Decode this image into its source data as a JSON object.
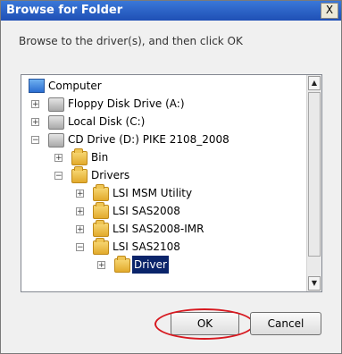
{
  "window": {
    "title": "Browse for Folder",
    "close_glyph": "X"
  },
  "instruction": "Browse to the driver(s), and then click OK",
  "tree": {
    "items": [
      {
        "label": "Computer",
        "icon": "computer-icon",
        "expander": ""
      },
      {
        "label": "Floppy Disk Drive (A:)",
        "icon": "floppy-drive-icon",
        "expander": "+"
      },
      {
        "label": "Local Disk (C:)",
        "icon": "hard-drive-icon",
        "expander": "+"
      },
      {
        "label": "CD Drive (D:) PIKE 2108_2008",
        "icon": "cd-drive-icon",
        "expander": "−"
      },
      {
        "label": "Bin",
        "icon": "folder-icon",
        "expander": "+"
      },
      {
        "label": "Drivers",
        "icon": "folder-icon",
        "expander": "−"
      },
      {
        "label": "LSI MSM Utility",
        "icon": "folder-icon",
        "expander": "+"
      },
      {
        "label": "LSI SAS2008",
        "icon": "folder-icon",
        "expander": "+"
      },
      {
        "label": "LSI SAS2008-IMR",
        "icon": "folder-icon",
        "expander": "+"
      },
      {
        "label": "LSI SAS2108",
        "icon": "folder-icon",
        "expander": "−"
      },
      {
        "label": "Driver",
        "icon": "folder-icon",
        "expander": "+",
        "selected": true
      }
    ]
  },
  "buttons": {
    "ok": "OK",
    "cancel": "Cancel"
  },
  "colors": {
    "titlebar": "#1f4fb5",
    "selection": "#0a246a",
    "highlight_circle": "#d71920"
  }
}
